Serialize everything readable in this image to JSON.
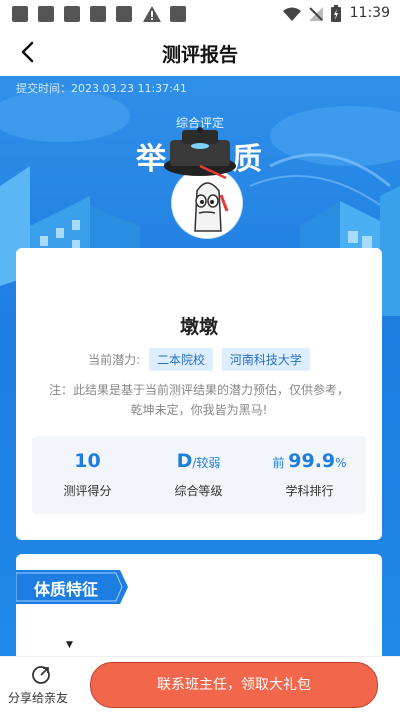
{
  "status_bar": {
    "time": "11:39"
  },
  "header": {
    "title": "测评报告",
    "back_icon": "chevron-left-icon"
  },
  "hero": {
    "submit_time": "提交时间：2023.03.23 11:37:41",
    "eval_label": "综合评定",
    "eval_title": "举人体质"
  },
  "profile": {
    "name": "墩墩",
    "potential_label": "当前潜力:",
    "tags": [
      "二本院校",
      "河南科技大学"
    ],
    "note_line1": "注：此结果是基于当前测评结果的潜力预估，仅供参考，",
    "note_line2": "乾坤未定，你我皆为黑马!"
  },
  "stats": [
    {
      "value": "10",
      "suffix": "",
      "prefix": "",
      "label": "测评得分"
    },
    {
      "value": "D",
      "suffix": "/较弱",
      "prefix": "",
      "label": "综合等级"
    },
    {
      "value": "99.9",
      "suffix": "%",
      "prefix": "前 ",
      "label": "学科排行"
    }
  ],
  "section": {
    "title": "体质特征"
  },
  "bottom_bar": {
    "share_label": "分享给亲友",
    "cta_label": "联系班主任，领取大礼包"
  },
  "colors": {
    "accent": "#1e7de0",
    "cta": "#f2674b"
  }
}
